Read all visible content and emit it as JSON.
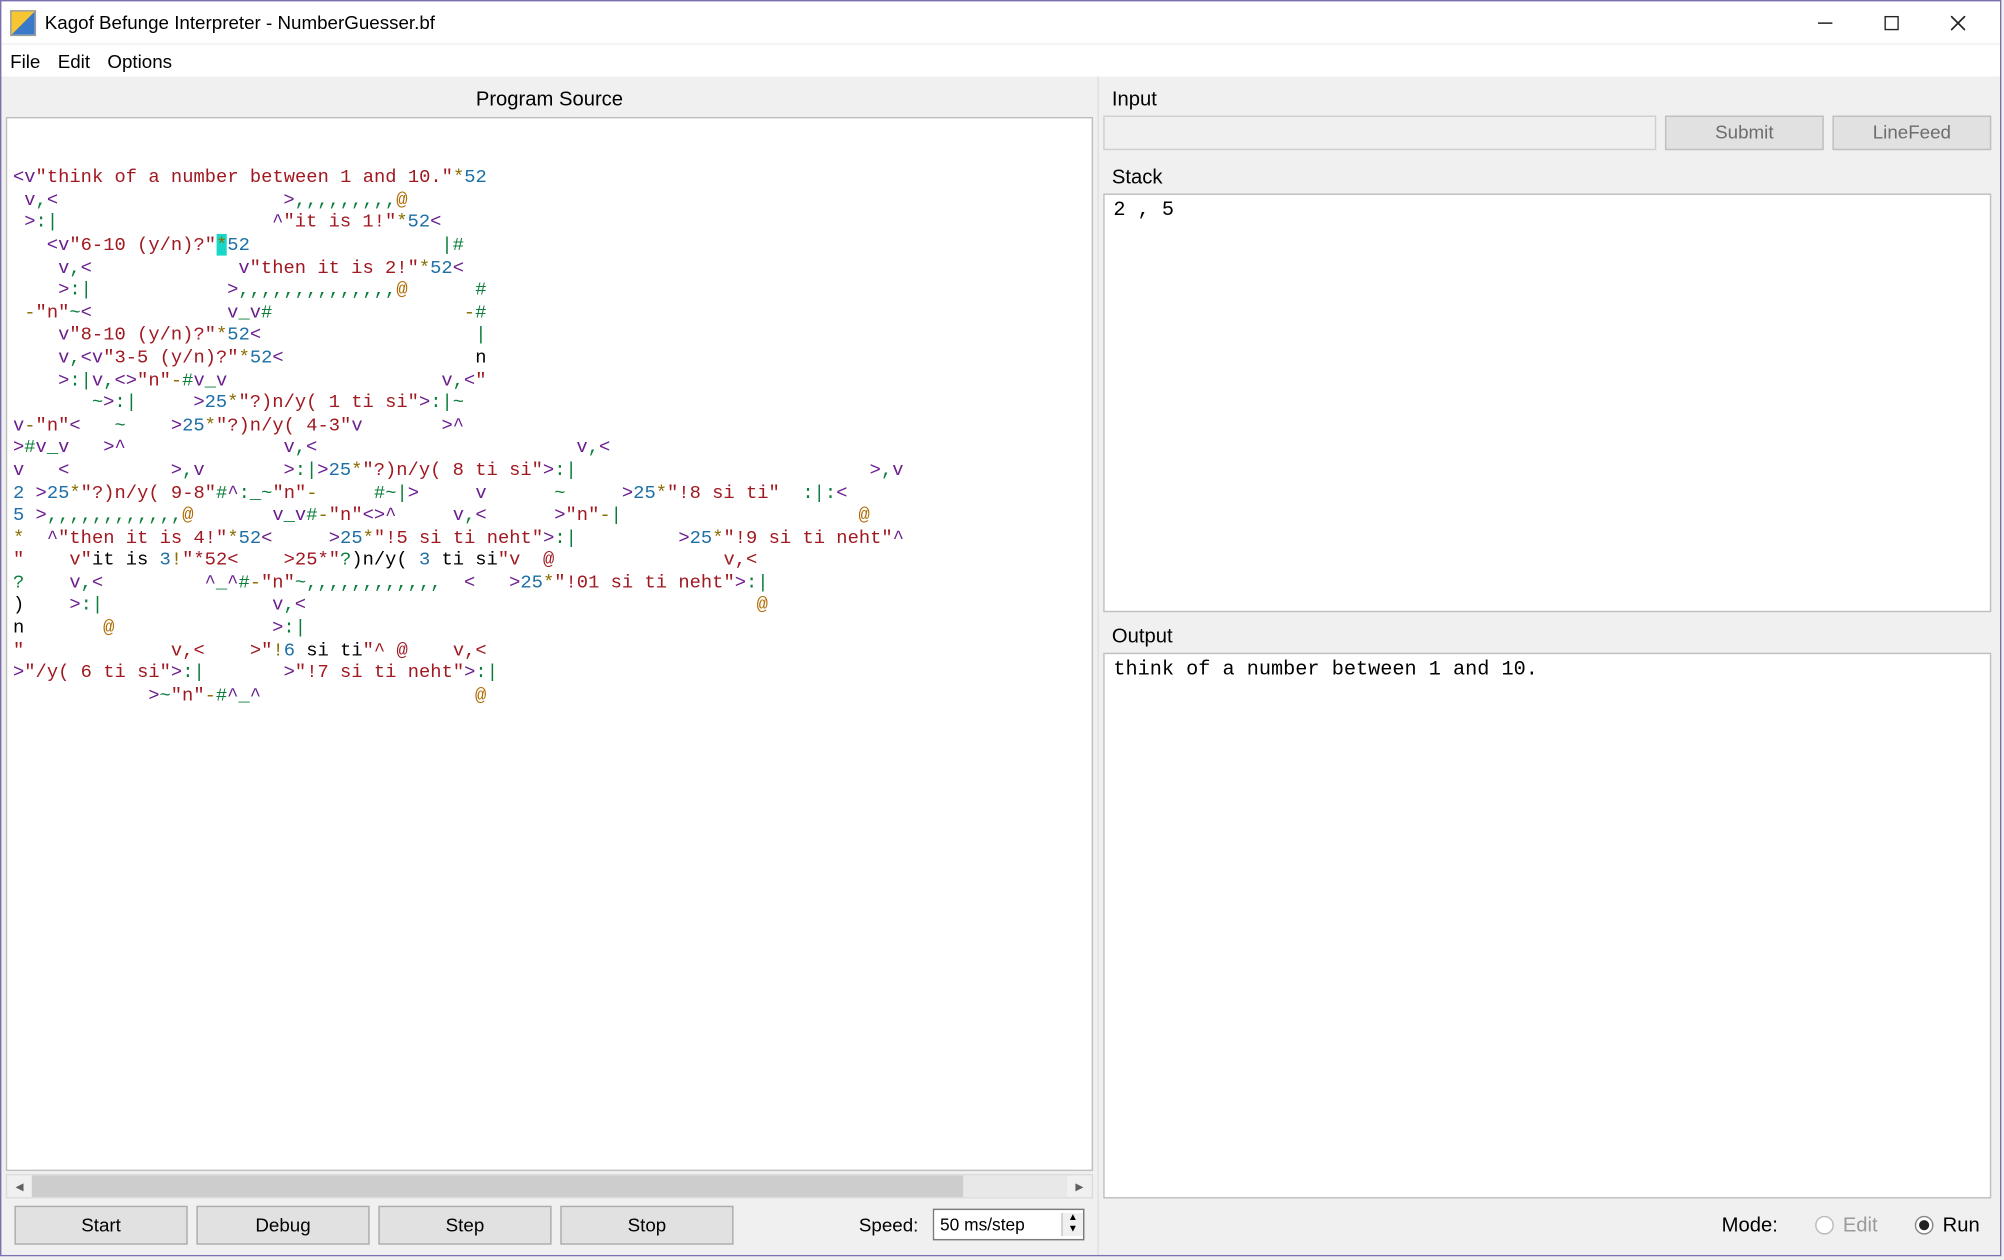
{
  "window": {
    "title": "Kagof Befunge Interpreter - NumberGuesser.bf"
  },
  "menubar": {
    "file": "File",
    "edit": "Edit",
    "options": "Options"
  },
  "panels": {
    "program_source_title": "Program Source",
    "input_title": "Input",
    "stack_title": "Stack",
    "output_title": "Output"
  },
  "input": {
    "value": "",
    "submit_label": "Submit",
    "linefeed_label": "LineFeed"
  },
  "stack": {
    "content": "2 , 5"
  },
  "output": {
    "content": "think of a number between 1 and 10."
  },
  "controls": {
    "start": "Start",
    "debug": "Debug",
    "step": "Step",
    "stop": "Stop",
    "speed_label": "Speed:",
    "speed_value": "50 ms/step"
  },
  "mode": {
    "label": "Mode:",
    "edit_label": "Edit",
    "run_label": "Run",
    "selected": "run"
  },
  "source_lines": [
    "<v\"think of a number between 1 and 10.\"*52",
    " v,<                    >,,,,,,,,,@",
    " >:|                   ^\"it is 1!\"*52<",
    "   <v\"6-10 (y/n)?\"*52                 |#",
    "    v,<             v\"then it is 2!\"*52<",
    "    >:|            >,,,,,,,,,,,,,,@      #",
    " -\"n\"~<            v_v#                 -#",
    "    v\"8-10 (y/n)?\"*52<                   |",
    "    v,<v\"3-5 (y/n)?\"*52<                 n",
    "    >:|v,<>\"n\"-#v_v                   v,<\"",
    "       ~>:|     >25*\"?)n/y( 1 ti si\">:|~",
    "v-\"n\"<   ~    >25*\"?)n/y( 4-3\"v       >^",
    ">#v_v   >^              v,<                       v,<",
    "v   <         >,v       >:|>25*\"?)n/y( 8 ti si\">:|                          >,v",
    "2 >25*\"?)n/y( 9-8\"#^:_~\"n\"-     #~|>     v      ~     >25*\"!8 si ti\"  :|:<",
    "5 >,,,,,,,,,,,,@       v_v#-\"n\"<>^     v,<      >\"n\"-|                     @",
    "*  ^\"then it is 4!\"*52<     >25*\"!5 si ti neht\">:|         >25*\"!9 si ti neht\"^",
    "\"    v\"it is 3!\"*52<    >25*\"?)n/y( 3 ti si\"v  @               v,<",
    "?    v,<         ^_^#-\"n\"~,,,,,,,,,,,,  <   >25*\"!01 si ti neht\">:|",
    ")    >:|               v,<                                        @",
    "n       @              >:|",
    "\"             v,<    >\"!6 si ti\"^ @    v,<",
    ">\"/y( 6 ti si\">:|       >\"!7 si ti neht\">:|",
    "            >~\"n\"-#^_^                   @"
  ]
}
